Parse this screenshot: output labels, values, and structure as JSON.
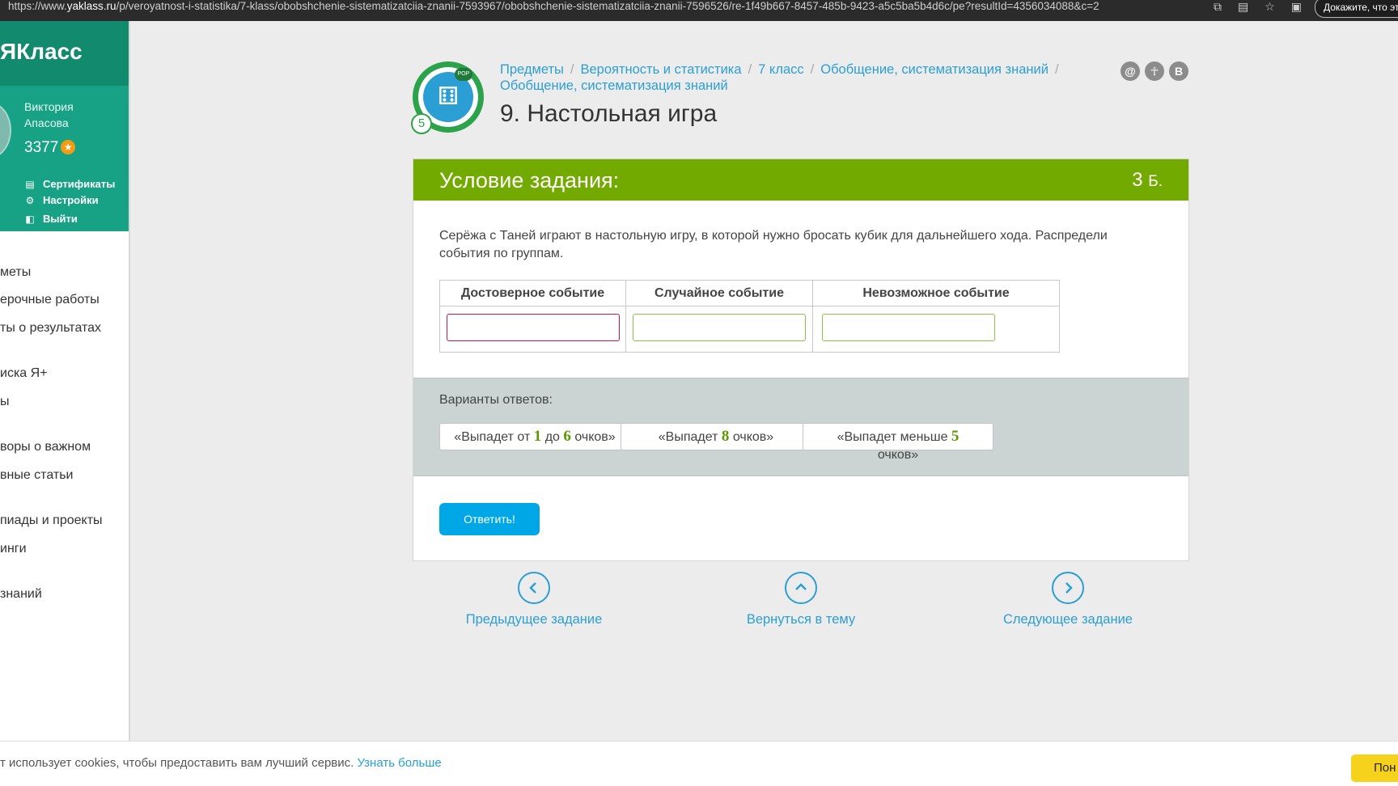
{
  "browser": {
    "url_prefix": "https://www.",
    "url_domain": "yaklass.ru",
    "url_path": "/p/veroyatnost-i-statistika/7-klass/obobshchenie-sistematizatciia-znanii-7593967/obobshchenie-sistematizatciia-znanii-7596526/re-1f49b667-8457-485b-9423-a5c5ba5b4d6c/pe?resultId=4356034088&c=2",
    "promo": "Докажите, что эт"
  },
  "sidebar": {
    "logo": "ЯКласс",
    "user_first": "Виктория",
    "user_last": "Апасова",
    "points": "3377",
    "links": [
      "Сертификаты",
      "Настройки",
      "Выйти"
    ],
    "menu": [
      "меты",
      "ерочные работы",
      "ты о результатах",
      "иска Я+",
      "ы",
      "воры о важном",
      "вные статьи",
      "пиады и проекты",
      "инги",
      "знаний"
    ]
  },
  "header": {
    "breadcrumbs": [
      "Предметы",
      "Вероятность и статистика",
      "7 класс",
      "Обобщение, систематизация знаний"
    ],
    "breadcrumb_second_line": "Обобщение, систематизация знаний",
    "title": "9. Настольная игра",
    "level": "5",
    "badge": "РОР",
    "share": [
      "@",
      "ok",
      "В"
    ]
  },
  "task": {
    "heading": "Условие задания:",
    "points": "3",
    "points_unit": "Б.",
    "question": "Серёжа с Таней играют в настольную игру, в которой нужно бросать кубик для дальнейшего хода. Распредели события по группам.",
    "columns": [
      "Достоверное событие",
      "Случайное событие",
      "Невозможное событие"
    ],
    "answers_label": "Варианты ответов:",
    "answers": [
      {
        "pre": "«Выпадет от ",
        "n1": "1",
        "mid": " до ",
        "n2": "6",
        "post": " очков»"
      },
      {
        "pre": "«Выпадет ",
        "n1": "8",
        "post": " очков»"
      },
      {
        "pre": "«Выпадет меньше ",
        "n1": "5",
        "post": "очков»"
      }
    ],
    "submit": "Ответить!"
  },
  "nav": {
    "prev": "Предыдущее задание",
    "back": "Вернуться в тему",
    "next": "Следующее задание"
  },
  "cookie": {
    "text": "т использует cookies, чтобы предоставить вам лучший сервис. ",
    "link": "Узнать больше",
    "button": "Пон"
  },
  "colors": {
    "green_header": "#72aa00",
    "teal_sidebar": "#17a286",
    "link_blue": "#2b9fd3",
    "submit_blue": "#00a7e6",
    "drop_pink": "#c2185b",
    "drop_green": "#8bc34a"
  }
}
